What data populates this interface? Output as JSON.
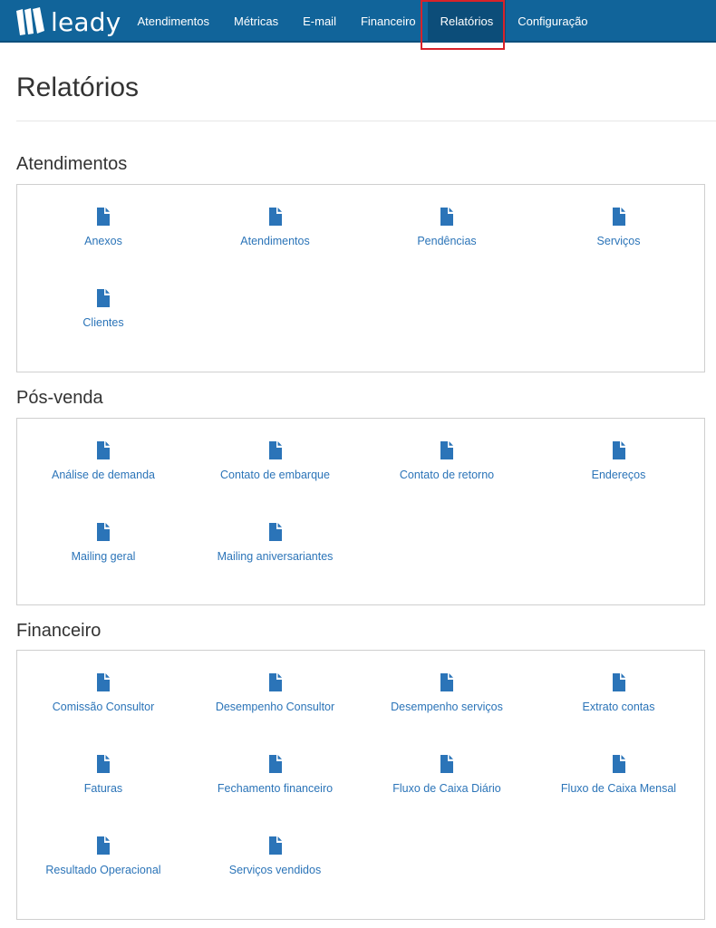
{
  "brand": {
    "name": "leady"
  },
  "nav": {
    "items": [
      "Atendimentos",
      "Métricas",
      "E-mail",
      "Financeiro",
      "Relatórios",
      "Configuração"
    ],
    "active": "Relatórios"
  },
  "page": {
    "title": "Relatórios"
  },
  "sections": [
    {
      "title": "Atendimentos",
      "items": [
        "Anexos",
        "Atendimentos",
        "Pendências",
        "Serviços",
        "Clientes"
      ]
    },
    {
      "title": "Pós-venda",
      "items": [
        "Análise de demanda",
        "Contato de embarque",
        "Contato de retorno",
        "Endereços",
        "Mailing geral",
        "Mailing aniversariantes"
      ]
    },
    {
      "title": "Financeiro",
      "items": [
        "Comissão Consultor",
        "Desempenho Consultor",
        "Desempenho serviços",
        "Extrato contas",
        "Faturas",
        "Fechamento financeiro",
        "Fluxo de Caixa Diário",
        "Fluxo de Caixa Mensal",
        "Resultado Operacional",
        "Serviços vendidos"
      ]
    }
  ],
  "colors": {
    "navbar": "#11649a",
    "active_nav": "#0c4d79",
    "link": "#2b74b8",
    "highlight": "#d8232a"
  },
  "icons": {
    "report_item": "file-icon",
    "brand": "leady-logo-icon"
  }
}
